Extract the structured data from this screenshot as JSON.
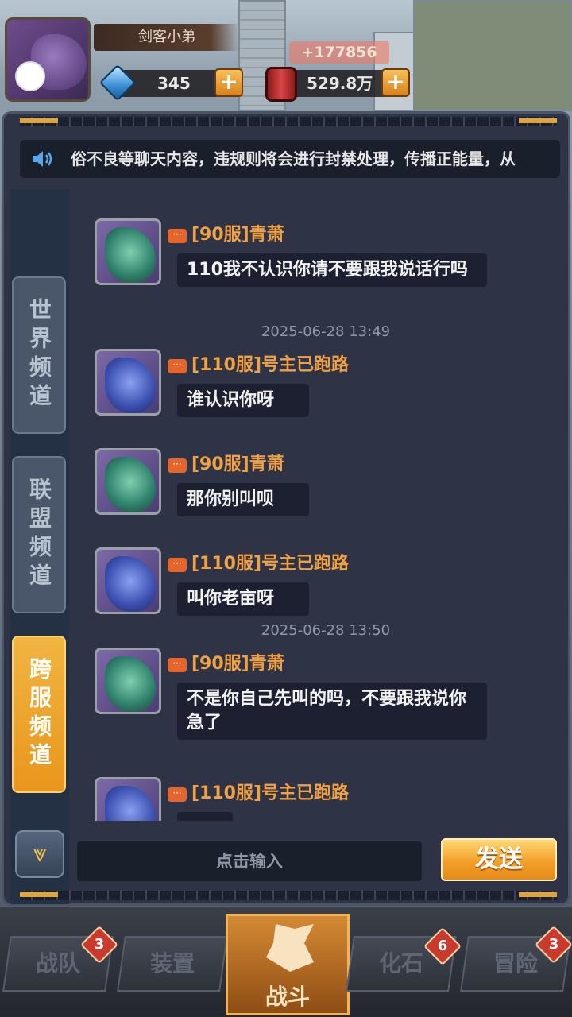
{
  "hud": {
    "player_name": "剑客小弟",
    "gems": "345",
    "cans": "529.8万",
    "bonus": "+177856",
    "plus_label": "+"
  },
  "announcement": "俗不良等聊天内容，违规则将会进行封禁处理，传播正能量，从",
  "tabs": [
    {
      "label": "世界频道",
      "active": false
    },
    {
      "label": "联盟频道",
      "active": false
    },
    {
      "label": "跨服频道",
      "active": true
    }
  ],
  "messages": [
    {
      "sender": "[90服]青萧",
      "text": "110我不认识你请不要跟我说话行吗",
      "avatar": "green"
    },
    {
      "sender": "[110服]号主已跑路",
      "text": "谁认识你呀",
      "avatar": "blue"
    },
    {
      "sender": "[90服]青萧",
      "text": "那你别叫呗",
      "avatar": "green"
    },
    {
      "sender": "[110服]号主已跑路",
      "text": "叫你老亩呀",
      "avatar": "blue"
    },
    {
      "sender": "[90服]青萧",
      "text": "不是你自己先叫的吗，不要跟我说你急了",
      "avatar": "green"
    },
    {
      "sender": "[110服]号主已跑路",
      "text": "…",
      "avatar": "blue"
    }
  ],
  "timestamps": [
    "2025-06-28 13:49",
    "2025-06-28 13:50"
  ],
  "input": {
    "placeholder": "点击输入",
    "send_label": "发送"
  },
  "scroll_down_label": "⩔",
  "nav": [
    {
      "label": "战队",
      "badge": "3"
    },
    {
      "label": "装置",
      "badge": ""
    },
    {
      "label": "战斗",
      "badge": ""
    },
    {
      "label": "化石",
      "badge": "6"
    },
    {
      "label": "冒险",
      "badge": "3"
    }
  ],
  "colors": {
    "accent": "#f0a045",
    "panel": "#2e3446",
    "send": "#f2a02a"
  }
}
